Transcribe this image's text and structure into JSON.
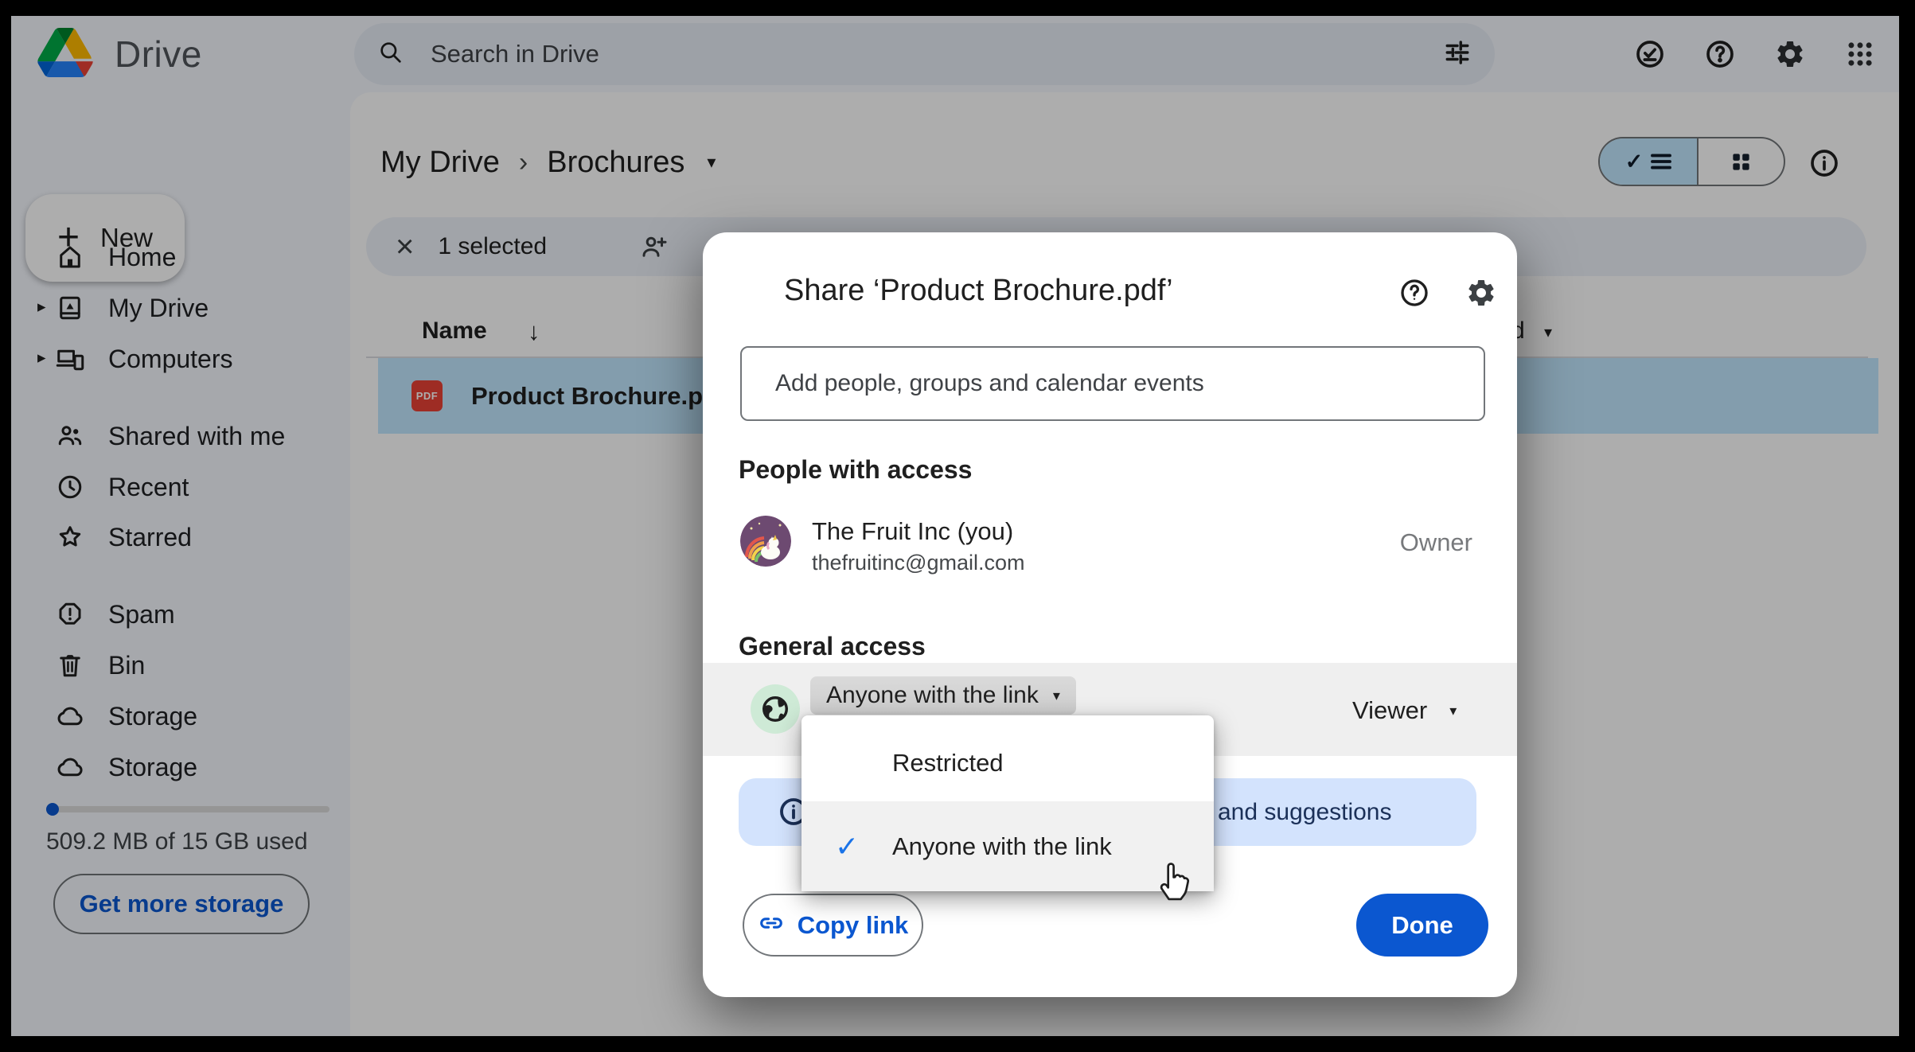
{
  "glyphs": {
    "plus": "+",
    "expand": "▸",
    "chevron": "›",
    "caret_down": "▾",
    "sort_down": "↓",
    "close": "×",
    "check": "✓",
    "question": "?"
  },
  "topbar": {
    "brand": "Drive",
    "search_placeholder": "Search in Drive"
  },
  "sidebar": {
    "new_label": "New",
    "items": [
      {
        "label": "Home"
      },
      {
        "label": "My Drive"
      },
      {
        "label": "Computers"
      },
      {
        "label": "Shared with me"
      },
      {
        "label": "Recent"
      },
      {
        "label": "Starred"
      },
      {
        "label": "Spam"
      },
      {
        "label": "Bin"
      },
      {
        "label": "Storage"
      },
      {
        "label": "Storage"
      }
    ],
    "storage_used": "509.2 MB of 15 GB used",
    "get_more_label": "Get more storage"
  },
  "breadcrumb": {
    "root": "My Drive",
    "current": "Brochures"
  },
  "selection_toolbar": {
    "count": "1 selected"
  },
  "file_table": {
    "name_header": "Name",
    "modified_header_partial": "d",
    "row": {
      "name": "Product Brochure.pdf",
      "badge": "PDF"
    }
  },
  "share_dialog": {
    "title": "Share ‘Product Brochure.pdf’",
    "input_placeholder": "Add people, groups and calendar events",
    "people_header": "People with access",
    "person": {
      "name": "The Fruit Inc (you)",
      "email": "thefruitinc@gmail.com",
      "role": "Owner"
    },
    "general_header": "General access",
    "access_button": "Anyone with the link",
    "role_button": "Viewer",
    "menu": {
      "options": [
        {
          "label": "Restricted"
        },
        {
          "label": "Anyone with the link"
        }
      ]
    },
    "banner_text_visible": "and suggestions",
    "copy_link_label": "Copy link",
    "done_label": "Done"
  },
  "colors": {
    "accent_blue": "#0b57d0",
    "selection_blue": "#c2e7ff",
    "banner_blue": "#d3e3fd",
    "access_green": "#ceead6",
    "pdf_red": "#e94235",
    "check_blue": "#1a73e8"
  }
}
